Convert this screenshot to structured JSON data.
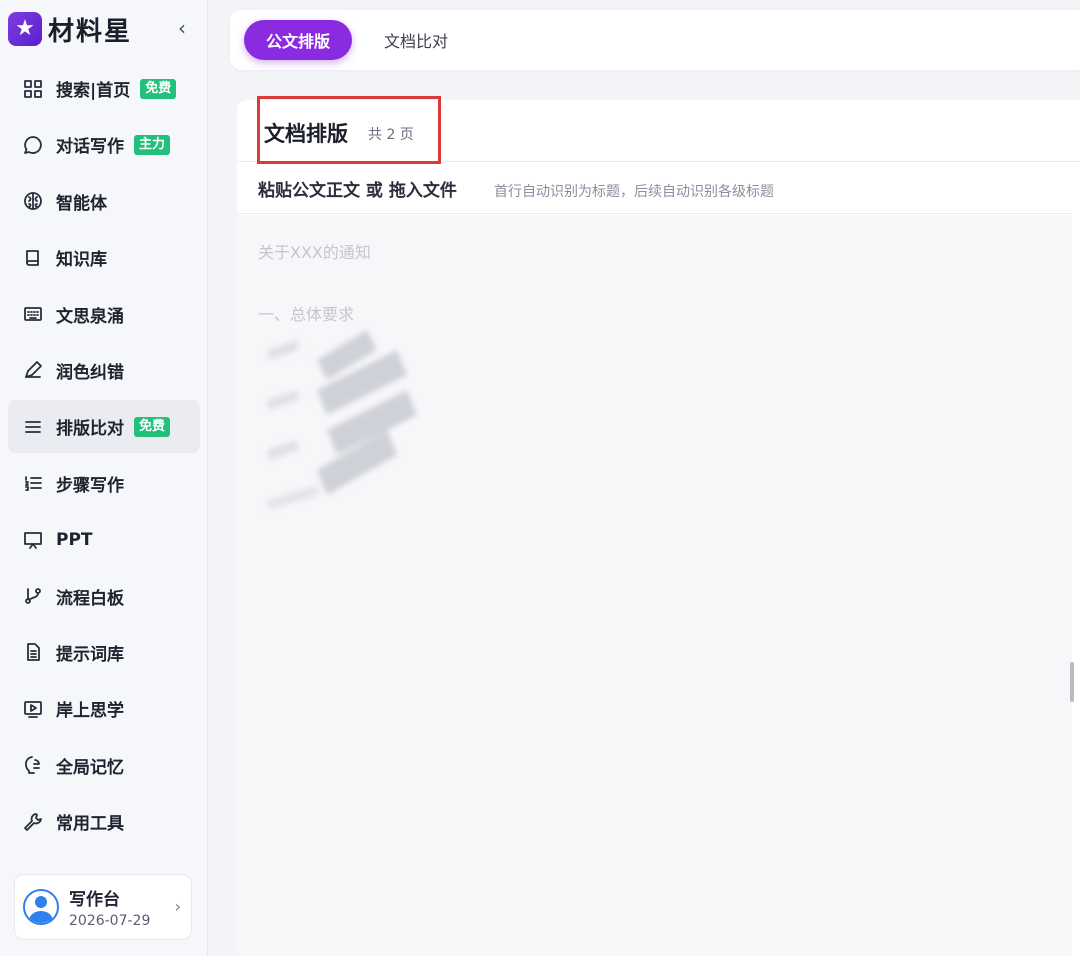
{
  "brand": {
    "logo_text": "材料星",
    "collapse_icon": "chevron-left-icon"
  },
  "sidebar": {
    "items": [
      {
        "label": "搜索|首页",
        "icon": "grid-icon",
        "badge": "免费"
      },
      {
        "label": "对话写作",
        "icon": "chat-bubble-icon",
        "badge": "主力"
      },
      {
        "label": "智能体",
        "icon": "brain-icon"
      },
      {
        "label": "知识库",
        "icon": "book-icon"
      },
      {
        "label": "文思泉涌",
        "icon": "keyboard-icon"
      },
      {
        "label": "润色纠错",
        "icon": "pencil-icon"
      },
      {
        "label": "排版比对",
        "icon": "menu-lines-icon",
        "badge": "免费",
        "active": true
      },
      {
        "label": "步骤写作",
        "icon": "numbered-list-icon"
      },
      {
        "label": "PPT",
        "icon": "presentation-icon"
      },
      {
        "label": "流程白板",
        "icon": "flow-branch-icon"
      },
      {
        "label": "提示词库",
        "icon": "document-icon"
      },
      {
        "label": "岸上思学",
        "icon": "video-play-icon"
      },
      {
        "label": "全局记忆",
        "icon": "memory-icon"
      },
      {
        "label": "常用工具",
        "icon": "wrench-icon"
      }
    ],
    "workspace": {
      "title": "写作台",
      "date": "2026-07-29"
    }
  },
  "tabs": [
    {
      "label": "公文排版",
      "active": true
    },
    {
      "label": "文档比对",
      "active": false
    }
  ],
  "document": {
    "title": "文档排版",
    "page_count": "共 2 页",
    "paste_label": "粘贴公文正文 或 拖入文件",
    "paste_hint": "首行自动识别为标题，后续自动识别各级标题",
    "placeholder_line1": "关于XXX的通知",
    "placeholder_line2": "一、总体要求"
  },
  "colors": {
    "accent": "#8a2be2",
    "badge_green": "#22c07a",
    "highlight_red": "#d93a3a"
  }
}
